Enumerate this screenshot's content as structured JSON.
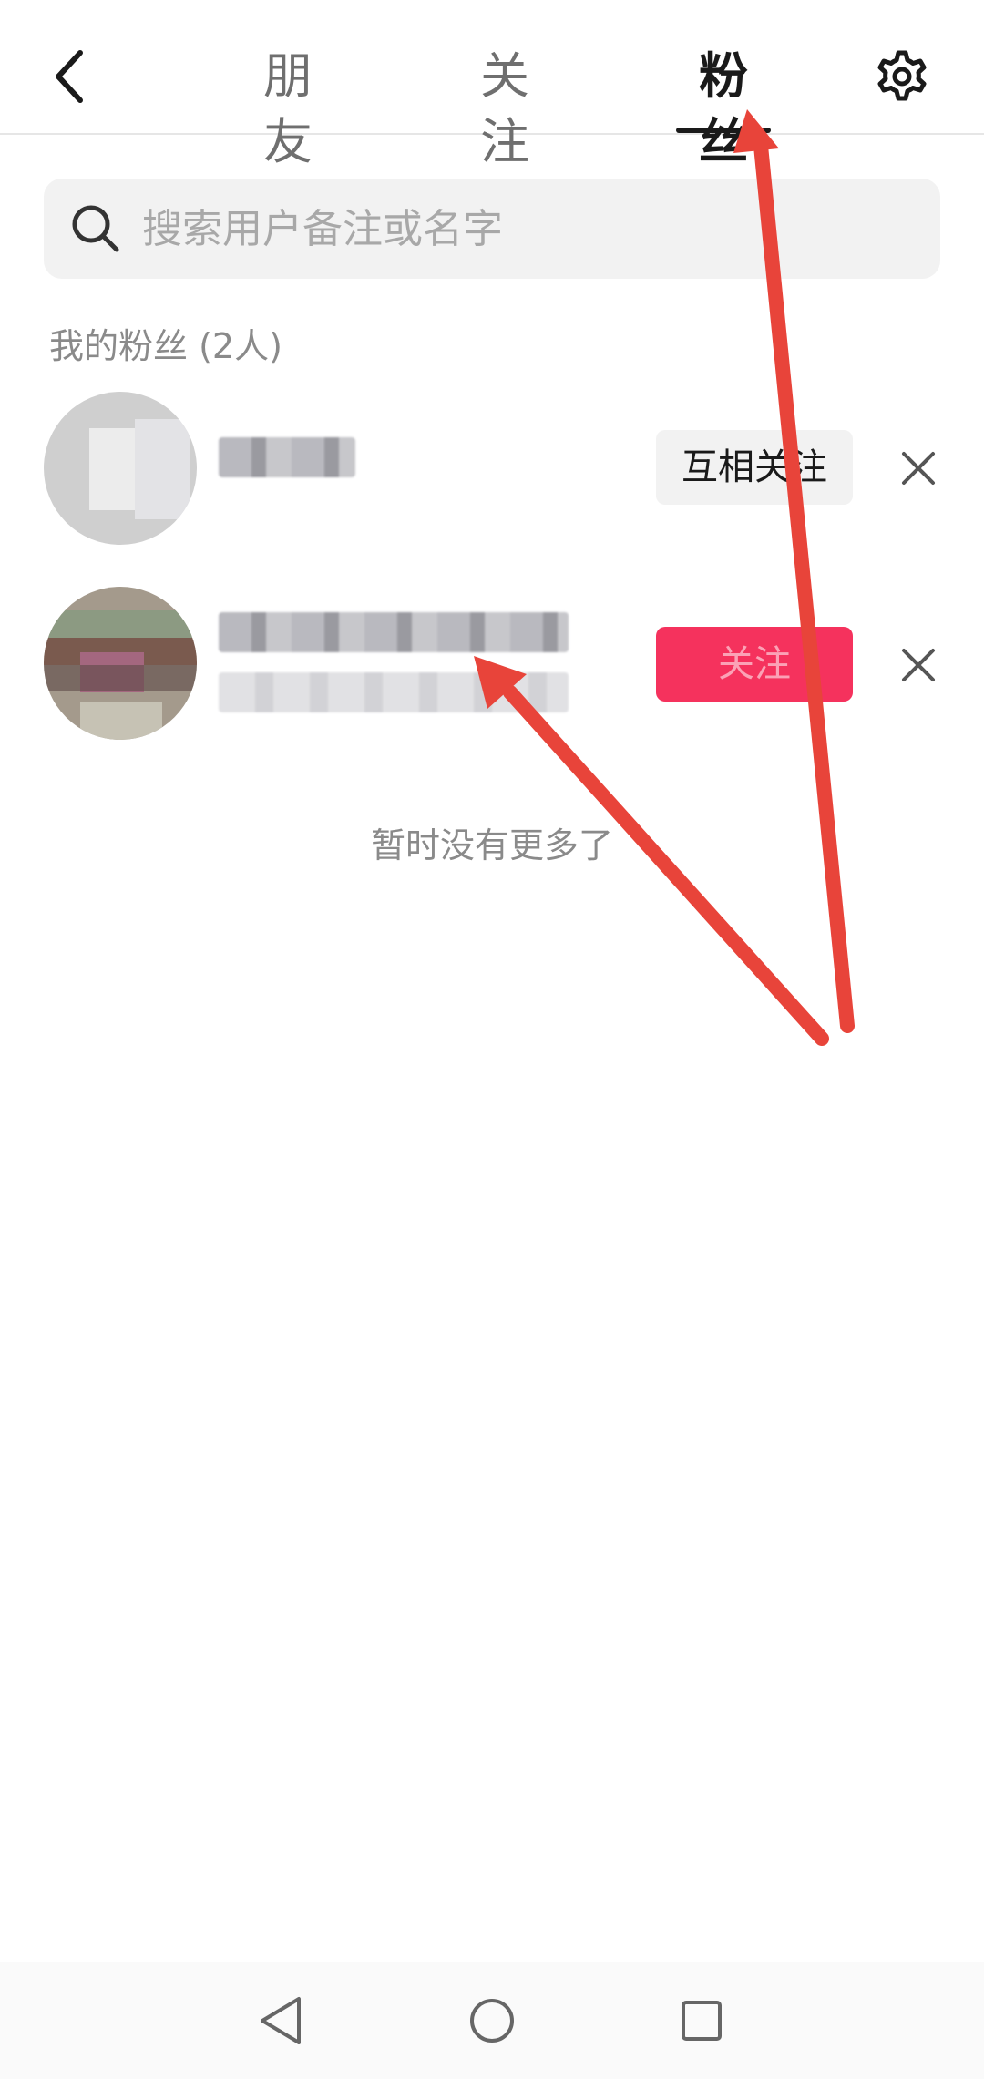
{
  "header": {
    "tabs": [
      {
        "label": "朋友"
      },
      {
        "label": "关注"
      },
      {
        "label": "粉丝",
        "active": true
      }
    ],
    "icons": {
      "back": "chevron-left-icon",
      "settings": "gear-icon"
    }
  },
  "search": {
    "placeholder": "搜索用户备注或名字",
    "value": "",
    "icon": "search-icon"
  },
  "followers": {
    "section_title": "我的粉丝 (2人)",
    "rows": [
      {
        "button_label": "互相关注",
        "button_style": "mutual"
      },
      {
        "button_label": "关注",
        "button_style": "follow",
        "button_color": "#f5325d"
      }
    ],
    "end_text": "暂时没有更多了"
  },
  "annotation": {
    "arrow_color": "#e8443a"
  },
  "system_nav": {
    "icons": [
      "back-triangle-icon",
      "home-circle-icon",
      "recents-square-icon"
    ]
  }
}
